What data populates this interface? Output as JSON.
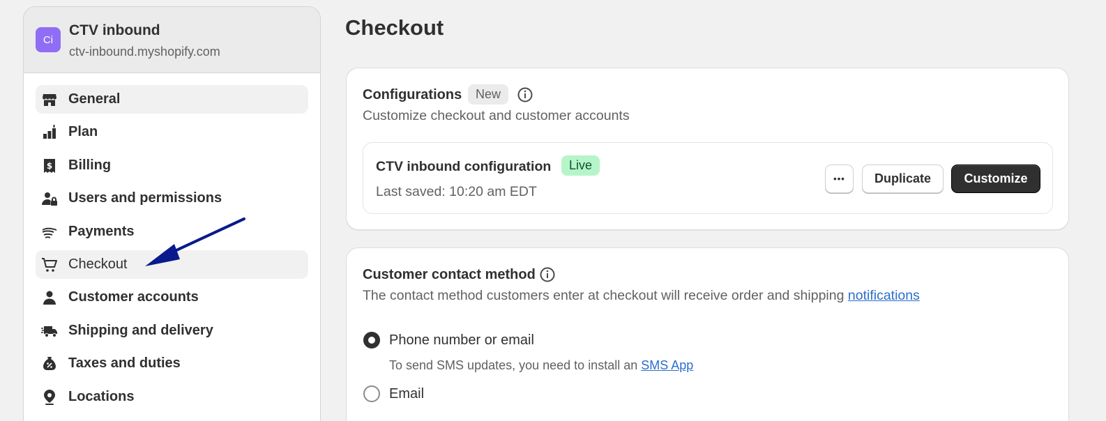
{
  "store": {
    "initials": "Ci",
    "name": "CTV inbound",
    "domain": "ctv-inbound.myshopify.com",
    "avatar_color": "#8f6ef5"
  },
  "nav": {
    "items": [
      {
        "label": "General",
        "icon": "store-icon"
      },
      {
        "label": "Plan",
        "icon": "plan-icon"
      },
      {
        "label": "Billing",
        "icon": "billing-icon"
      },
      {
        "label": "Users and permissions",
        "icon": "users-icon"
      },
      {
        "label": "Payments",
        "icon": "payments-icon"
      },
      {
        "label": "Checkout",
        "icon": "cart-icon"
      },
      {
        "label": "Customer accounts",
        "icon": "person-icon"
      },
      {
        "label": "Shipping and delivery",
        "icon": "truck-icon"
      },
      {
        "label": "Taxes and duties",
        "icon": "tax-icon"
      },
      {
        "label": "Locations",
        "icon": "location-icon"
      }
    ]
  },
  "page": {
    "title": "Checkout"
  },
  "configurations": {
    "title": "Configurations",
    "badge": "New",
    "subtitle": "Customize checkout and customer accounts",
    "config": {
      "name": "CTV inbound configuration",
      "status": "Live",
      "saved": "Last saved: 10:20 am EDT",
      "more_label": "•••",
      "duplicate_label": "Duplicate",
      "customize_label": "Customize"
    }
  },
  "contact": {
    "title": "Customer contact method",
    "description": "The contact method customers enter at checkout will receive order and shipping",
    "description_link": "notifications",
    "options": [
      {
        "label": "Phone number or email",
        "selected": true
      },
      {
        "label": "Email",
        "selected": false
      }
    ],
    "sms_hint": "To send SMS updates, you need to install an",
    "sms_link": "SMS App"
  },
  "colors": {
    "accent_link": "#2c6ecb",
    "live_badge": "#b5f5c9",
    "primary_button": "#303030",
    "annotation_arrow": "#0a1a8c"
  }
}
